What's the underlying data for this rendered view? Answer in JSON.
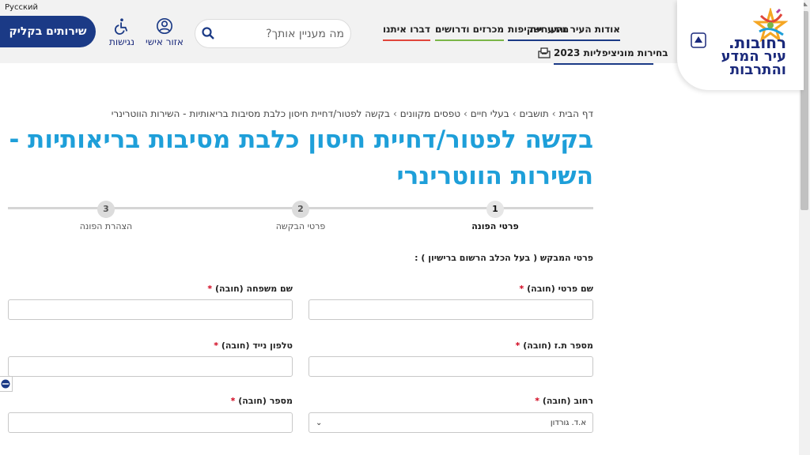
{
  "header": {
    "language_link": "Русский",
    "services_button": "שירותים בקליק",
    "accessibility_label": "נגישות",
    "personal_area_label": "אזור אישי",
    "search_placeholder": "מה מעניין אותך?",
    "nav": {
      "about": "אודות העיר והעירייה",
      "info": "מידע ושקיפות",
      "tenders": "מכרזים ודרושים",
      "contact": "דברו איתנו",
      "elections": "בחירות מוניציפליות 2023"
    },
    "logo": {
      "line1": "רחובות.",
      "line2": "עיר המדע",
      "line3": "והתרבות"
    },
    "colors": {
      "brand_blue": "#1b3a86",
      "title_blue": "#1e9fd9",
      "nav_underline_green": "#7ab648",
      "nav_underline_red": "#e0463b"
    }
  },
  "breadcrumb": [
    "דף הבית",
    "תושבים",
    "בעלי חיים",
    "טפסים מקוונים",
    "בקשה לפטור/דחיית חיסון כלבת מסיבות בריאותיות - השירות הווטרינרי"
  ],
  "page_title": "בקשה לפטור/דחיית חיסון כלבת מסיבות בריאותיות - השירות הווטרינרי",
  "steps": [
    {
      "number": "1",
      "label": "פרטי הפונה",
      "active": true
    },
    {
      "number": "2",
      "label": "פרטי הבקשה",
      "active": false
    },
    {
      "number": "3",
      "label": "הצהרת הפונה",
      "active": false
    }
  ],
  "form": {
    "section_label": "פרטי המבקש ( בעל הכלב הרשום ברישיון ) :",
    "first_name_label": "שם פרטי (חובה)",
    "last_name_label": "שם משפחה (חובה)",
    "id_label": "מספר ת.ז (חובה)",
    "phone_label": "טלפון נייד (חובה)",
    "street_label": "רחוב (חובה)",
    "street_value": "א.ד. גורדון",
    "number_label": "מספר (חובה)",
    "required_mark": "*"
  }
}
